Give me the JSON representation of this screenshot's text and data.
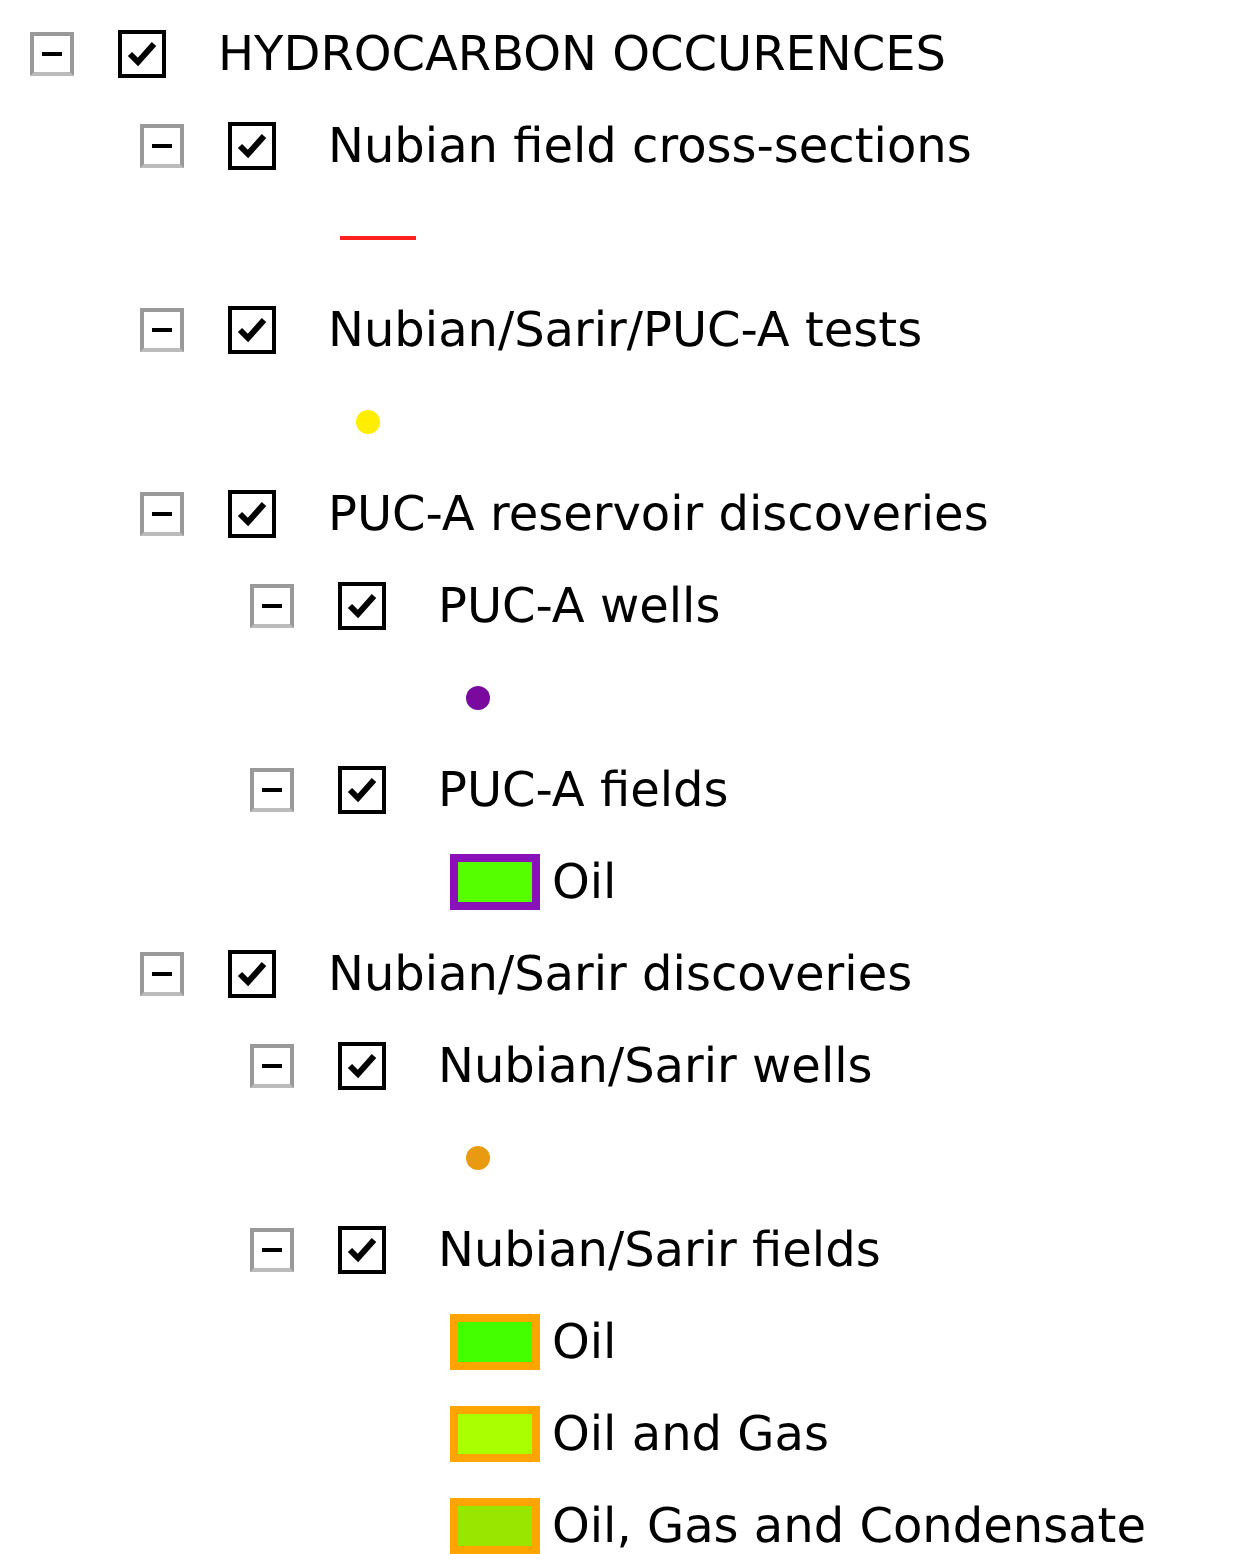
{
  "layers": [
    {
      "label": "HYDROCARBON OCCURENCES",
      "expanded": true,
      "checked": true,
      "children": [
        {
          "label": "Nubian field cross-sections",
          "expanded": true,
          "checked": true,
          "legend": [
            {
              "kind": "line",
              "color": "#ff2020"
            }
          ]
        },
        {
          "label": "Nubian/Sarir/PUC-A tests",
          "expanded": true,
          "checked": true,
          "legend": [
            {
              "kind": "marker",
              "color": "#ffee00"
            }
          ]
        },
        {
          "label": "PUC-A reservoir discoveries",
          "expanded": true,
          "checked": true,
          "children": [
            {
              "label": "PUC-A wells",
              "expanded": true,
              "checked": true,
              "legend": [
                {
                  "kind": "marker",
                  "color": "#7a0a9e"
                }
              ]
            },
            {
              "label": "PUC-A fields",
              "expanded": true,
              "checked": true,
              "legend": [
                {
                  "kind": "patch",
                  "color": "#55ff00",
                  "border": {
                    "color": "#8a10b8"
                  },
                  "label": "Oil"
                }
              ]
            }
          ]
        },
        {
          "label": "Nubian/Sarir discoveries",
          "expanded": true,
          "checked": true,
          "children": [
            {
              "label": "Nubian/Sarir wells",
              "expanded": true,
              "checked": true,
              "legend": [
                {
                  "kind": "marker",
                  "color": "#e89a10"
                }
              ]
            },
            {
              "label": "Nubian/Sarir fields",
              "expanded": true,
              "checked": true,
              "legend": [
                {
                  "kind": "patch",
                  "color": "#44ff00",
                  "border": {
                    "color": "#ffa500"
                  },
                  "label": "Oil"
                },
                {
                  "kind": "patch",
                  "color": "#aaff00",
                  "border": {
                    "color": "#ffa500"
                  },
                  "label": "Oil and Gas"
                },
                {
                  "kind": "patch",
                  "color": "#99e600",
                  "border": {
                    "color": "#ffa500"
                  },
                  "label": "Oil, Gas and Condensate"
                }
              ]
            }
          ]
        }
      ]
    }
  ]
}
